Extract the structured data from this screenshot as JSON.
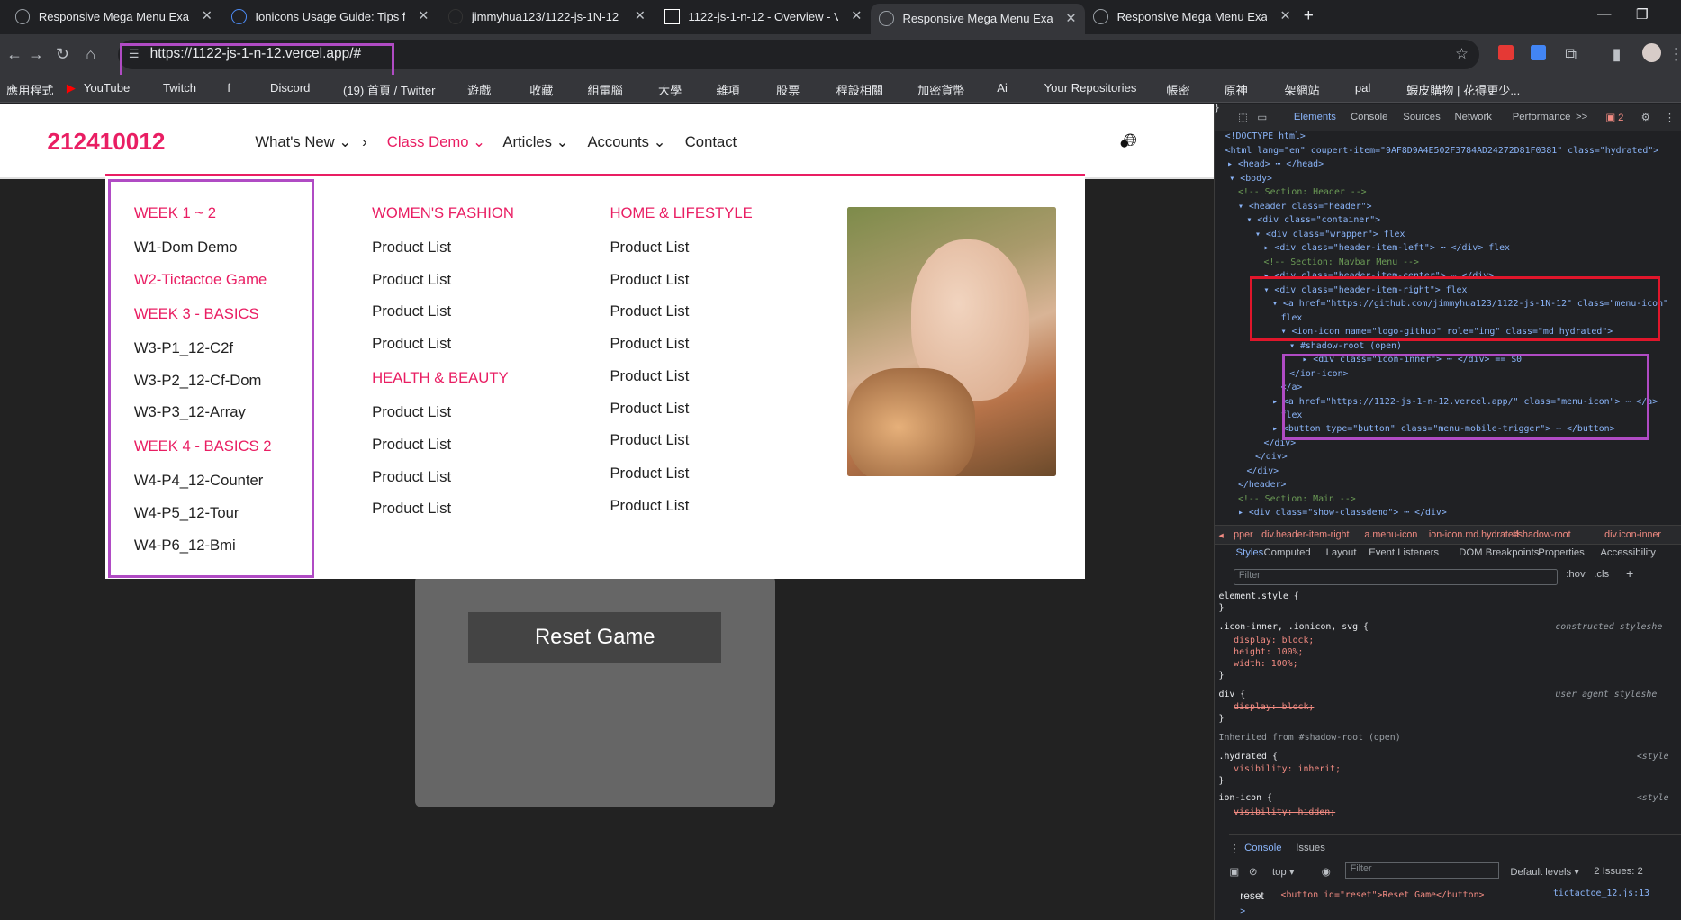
{
  "tabs": [
    {
      "title": "Responsive Mega Menu Exam"
    },
    {
      "title": "Ionicons Usage Guide: Tips fo"
    },
    {
      "title": "jimmyhua123/1122-js-1N-12"
    },
    {
      "title": "1122-js-1-n-12 - Overview - V"
    },
    {
      "title": "Responsive Mega Menu Exam"
    },
    {
      "title": "Responsive Mega Menu Exam"
    }
  ],
  "address": {
    "url": "https://1122-js-1-n-12.vercel.app/#"
  },
  "bookmarks": [
    "應用程式",
    "YouTube",
    "Twitch",
    "f",
    "Discord",
    "(19) 首頁 / Twitter",
    "遊戲",
    "收藏",
    "組電腦",
    "大學",
    "雜項",
    "股票",
    "程設相關",
    "加密貨幣",
    "Ai",
    "Your Repositories",
    "帳密",
    "原神",
    "架網站",
    "pal",
    "蝦皮購物 | 花得更少..."
  ],
  "site": {
    "logo": "212410012",
    "menu": [
      "What's New",
      "Class Demo",
      "Articles",
      "Accounts",
      "Contact"
    ],
    "reset_label": "Reset Game",
    "mega": {
      "col1": [
        {
          "t": "cat",
          "v": "WEEK 1 ~ 2"
        },
        {
          "t": "lk",
          "v": "W1-Dom Demo"
        },
        {
          "t": "cat",
          "v": "W2-Tictactoe Game"
        },
        {
          "t": "cat",
          "v": "WEEK 3 - BASICS"
        },
        {
          "t": "lk",
          "v": "W3-P1_12-C2f"
        },
        {
          "t": "lk",
          "v": "W3-P2_12-Cf-Dom"
        },
        {
          "t": "lk",
          "v": "W3-P3_12-Array"
        },
        {
          "t": "cat",
          "v": "WEEK 4 - BASICS 2"
        },
        {
          "t": "lk",
          "v": "W4-P4_12-Counter"
        },
        {
          "t": "lk",
          "v": "W4-P5_12-Tour"
        },
        {
          "t": "lk",
          "v": "W4-P6_12-Bmi"
        }
      ],
      "col2": [
        {
          "t": "cat",
          "v": "WOMEN'S FASHION"
        },
        {
          "t": "lk",
          "v": "Product List"
        },
        {
          "t": "lk",
          "v": "Product List"
        },
        {
          "t": "lk",
          "v": "Product List"
        },
        {
          "t": "lk",
          "v": "Product List"
        },
        {
          "t": "cat",
          "v": "HEALTH & BEAUTY"
        },
        {
          "t": "lk",
          "v": "Product List"
        },
        {
          "t": "lk",
          "v": "Product List"
        },
        {
          "t": "lk",
          "v": "Product List"
        },
        {
          "t": "lk",
          "v": "Product List"
        }
      ],
      "col3": [
        {
          "t": "cat",
          "v": "HOME & LIFESTYLE"
        },
        {
          "t": "lk",
          "v": "Product List"
        },
        {
          "t": "lk",
          "v": "Product List"
        },
        {
          "t": "lk",
          "v": "Product List"
        },
        {
          "t": "lk",
          "v": "Product List"
        },
        {
          "t": "lk",
          "v": "Product List"
        },
        {
          "t": "lk",
          "v": "Product List"
        },
        {
          "t": "lk",
          "v": "Product List"
        },
        {
          "t": "lk",
          "v": "Product List"
        },
        {
          "t": "lk",
          "v": "Product List"
        }
      ]
    }
  },
  "devtools": {
    "tabs": [
      "Elements",
      "Console",
      "Sources",
      "Network",
      "Performance",
      ">>"
    ],
    "issue_count": "2",
    "dom": [
      "<!DOCTYPE html>",
      "<html lang=\"en\" coupert-item=\"9AF8D9A4E502F3784AD24272D81F0381\" class=\"hydrated\">",
      "▸ <head> ⋯ </head>",
      "▾ <body>",
      "<!-- Section: Header -->",
      "▾ <header class=\"header\">",
      "▾ <div class=\"container\">",
      "▾ <div class=\"wrapper\"> flex",
      "▸ <div class=\"header-item-left\"> ⋯ </div> flex",
      "<!-- Section: Navbar Menu -->",
      "▸ <div class=\"header-item-center\"> ⋯ </div>",
      "▾ <div class=\"header-item-right\"> flex",
      "▾ <a href=\"https://github.com/jimmyhua123/1122-js-1N-12\" class=\"menu-icon\"",
      "flex",
      "▾ <ion-icon name=\"logo-github\" role=\"img\" class=\"md hydrated\">",
      "▾ #shadow-root (open)",
      "▸ <div class=\"icon-inner\"> ⋯ </div> == $0",
      "</ion-icon>",
      "</a>",
      "▸ <a href=\"https://1122-js-1-n-12.vercel.app/\" class=\"menu-icon\"> ⋯ </a>",
      "flex",
      "▸ <button type=\"button\" class=\"menu-mobile-trigger\"> ⋯ </button>",
      "</div>",
      "</div>",
      "</div>",
      "</header>",
      "<!-- Section: Main -->",
      "▸ <div class=\"show-classdemo\"> ⋯ </div>"
    ],
    "breadcrumb": [
      "◂",
      "pper",
      "div.header-item-right",
      "a.menu-icon",
      "ion-icon.md.hydrated",
      "#shadow-root",
      "div.icon-inner"
    ],
    "style_tabs": [
      "Styles",
      "Computed",
      "Layout",
      "Event Listeners",
      "DOM Breakpoints",
      "Properties",
      "Accessibility"
    ],
    "filter_placeholder": "Filter",
    "hov": ":hov",
    "cls": ".cls",
    "styles": [
      "element.style {",
      "}",
      ".icon-inner, .ionicon, svg {",
      "display: block;",
      "height: 100%;",
      "width: 100%;",
      "}",
      "div {",
      "display: block;",
      "}",
      "Inherited from #shadow-root (open)",
      ".hydrated {",
      "visibility: inherit;",
      "}",
      "ion-icon {",
      "visibility: hidden;",
      "}"
    ],
    "style_sources": [
      "constructed styleshe",
      "user agent styleshe",
      "<style",
      "<style"
    ],
    "console": {
      "tabs": [
        "Console",
        "Issues"
      ],
      "context": "top ▾",
      "filter": "Filter",
      "levels": "Default levels ▾",
      "issues": "2 Issues: 2",
      "log_text": "reset",
      "log_code": "<button id=\"reset\">Reset Game</button>",
      "log_source": "tictactoe_12.js:13",
      "prompt": ">"
    }
  }
}
